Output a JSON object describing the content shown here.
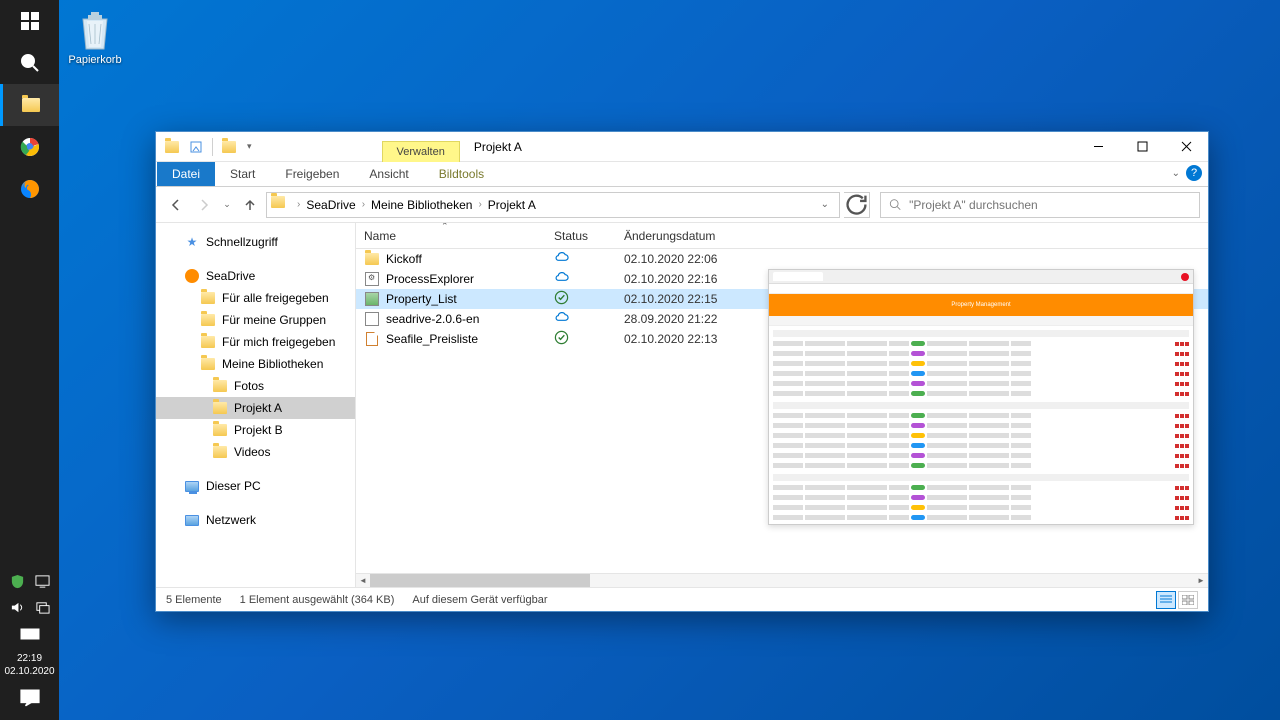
{
  "desktop": {
    "recycle_bin": "Papierkorb"
  },
  "taskbar": {
    "time": "22:19",
    "date": "02.10.2020"
  },
  "window": {
    "context_tab": "Verwalten",
    "title": "Projekt A",
    "ribbon": {
      "file": "Datei",
      "start": "Start",
      "share": "Freigeben",
      "view": "Ansicht",
      "context": "Bildtools"
    },
    "breadcrumb": {
      "seg1": "SeaDrive",
      "seg2": "Meine Bibliotheken",
      "seg3": "Projekt A"
    },
    "search": {
      "placeholder": "\"Projekt A\" durchsuchen"
    },
    "tree": {
      "quick": "Schnellzugriff",
      "seadrive": "SeaDrive",
      "shared_all": "Für alle freigegeben",
      "shared_groups": "Für meine Gruppen",
      "shared_me": "Für mich freigegeben",
      "my_libs": "Meine Bibliotheken",
      "fotos": "Fotos",
      "proj_a": "Projekt A",
      "proj_b": "Projekt B",
      "videos": "Videos",
      "this_pc": "Dieser PC",
      "network": "Netzwerk"
    },
    "columns": {
      "name": "Name",
      "status": "Status",
      "date": "Änderungsdatum"
    },
    "files": [
      {
        "name": "Kickoff",
        "status": "cloud",
        "date": "02.10.2020 22:06",
        "type": "folder"
      },
      {
        "name": "ProcessExplorer",
        "status": "cloud",
        "date": "02.10.2020 22:16",
        "type": "exe"
      },
      {
        "name": "Property_List",
        "status": "synced",
        "date": "02.10.2020 22:15",
        "type": "image",
        "selected": true
      },
      {
        "name": "seadrive-2.0.6-en",
        "status": "cloud",
        "date": "28.09.2020 21:22",
        "type": "installer"
      },
      {
        "name": "Seafile_Preisliste",
        "status": "synced",
        "date": "02.10.2020 22:13",
        "type": "doc"
      }
    ],
    "preview_title": "Property Management",
    "status": {
      "count": "5 Elemente",
      "selection": "1 Element ausgewählt (364 KB)",
      "availability": "Auf diesem Gerät verfügbar"
    }
  }
}
